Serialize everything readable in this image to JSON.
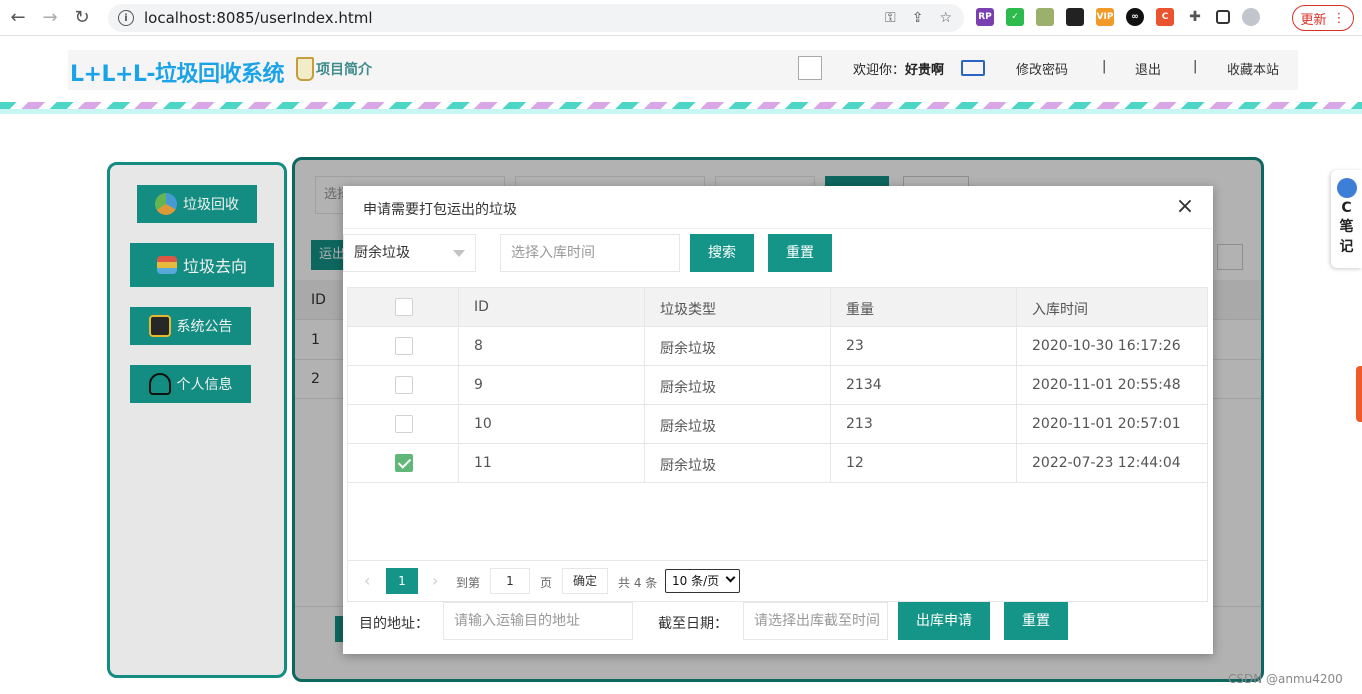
{
  "browser": {
    "url": "localhost:8085/userIndex.html",
    "update_label": "更新"
  },
  "header": {
    "title": "L+L+L-垃圾回收系统",
    "intro_link": "项目简介",
    "welcome_prefix": "欢迎你：",
    "username": "好贵啊",
    "change_password": "修改密码",
    "sep1": "|",
    "logout": "退出",
    "sep2": "|",
    "bookmark": "收藏本站"
  },
  "sidebar": {
    "items": [
      {
        "label": "垃圾回收",
        "icon": "recycle-icon"
      },
      {
        "label": "垃圾去向",
        "icon": "signpost-icon"
      },
      {
        "label": "系统公告",
        "icon": "briefcase-icon"
      },
      {
        "label": "个人信息",
        "icon": "person-icon"
      }
    ]
  },
  "background_panel": {
    "select_placeholder": "选择",
    "toolbar_button": "运出",
    "column_id": "ID",
    "rows": [
      "1",
      "2"
    ]
  },
  "modal": {
    "title": "申请需要打包运出的垃圾",
    "close_label": "×",
    "filter": {
      "type_value": "厨余垃圾",
      "time_placeholder": "选择入库时间",
      "search_button": "搜索",
      "reset_button": "重置"
    },
    "table": {
      "columns": [
        "ID",
        "垃圾类型",
        "重量",
        "入库时间"
      ],
      "rows": [
        {
          "id": "8",
          "type": "厨余垃圾",
          "weight": "23",
          "time": "2020-10-30 16:17:26",
          "checked": false
        },
        {
          "id": "9",
          "type": "厨余垃圾",
          "weight": "2134",
          "time": "2020-11-01 20:55:48",
          "checked": false
        },
        {
          "id": "10",
          "type": "厨余垃圾",
          "weight": "213",
          "time": "2020-11-01 20:57:01",
          "checked": false
        },
        {
          "id": "11",
          "type": "厨余垃圾",
          "weight": "12",
          "time": "2022-07-23 12:44:04",
          "checked": true
        }
      ]
    },
    "pager": {
      "prev": "‹",
      "current_page": "1",
      "next": "›",
      "goto_label": "到第",
      "goto_value": "1",
      "page_unit": "页",
      "confirm_button": "确定",
      "total": "共 4 条",
      "page_size": "10 条/页"
    },
    "form": {
      "destination_label": "目的地址：",
      "destination_placeholder": "请输入运输目的地址",
      "deadline_label": "截至日期：",
      "deadline_placeholder": "请选择出库截至时间",
      "submit_button": "出库申请",
      "reset_button": "重置"
    }
  },
  "side_widget": {
    "line1": "C",
    "line2": "笔",
    "line3": "记"
  },
  "watermark": "CSDN @anmu4200",
  "colors": {
    "primary": "#159488",
    "title_blue": "#1aa3e8",
    "checkbox_checked": "#5fb878"
  }
}
